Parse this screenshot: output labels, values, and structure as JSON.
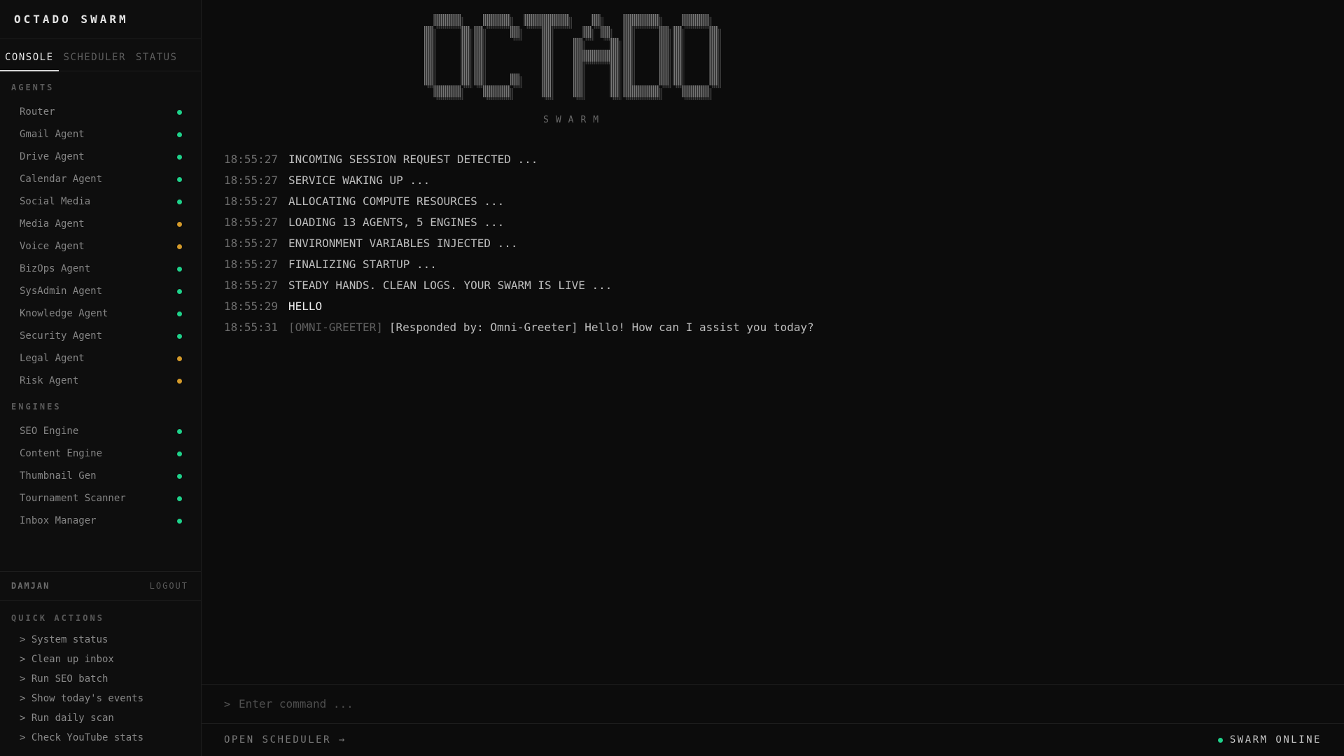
{
  "brand": "OCTADO SWARM",
  "tabs": [
    {
      "label": "CONSOLE",
      "active": true
    },
    {
      "label": "SCHEDULER",
      "active": false
    },
    {
      "label": "STATUS",
      "active": false
    }
  ],
  "sections": {
    "agents": "AGENTS",
    "engines": "ENGINES",
    "quick_actions": "QUICK ACTIONS"
  },
  "colors": {
    "online": "#1fd18a",
    "busy": "#d49a2a"
  },
  "agents": [
    {
      "label": "Router",
      "status": "online"
    },
    {
      "label": "Gmail Agent",
      "status": "online"
    },
    {
      "label": "Drive Agent",
      "status": "online"
    },
    {
      "label": "Calendar Agent",
      "status": "online"
    },
    {
      "label": "Social Media",
      "status": "online"
    },
    {
      "label": "Media Agent",
      "status": "busy"
    },
    {
      "label": "Voice Agent",
      "status": "busy"
    },
    {
      "label": "BizOps Agent",
      "status": "online"
    },
    {
      "label": "SysAdmin Agent",
      "status": "online"
    },
    {
      "label": "Knowledge Agent",
      "status": "online"
    },
    {
      "label": "Security Agent",
      "status": "online"
    },
    {
      "label": "Legal Agent",
      "status": "busy"
    },
    {
      "label": "Risk Agent",
      "status": "busy"
    }
  ],
  "engines": [
    {
      "label": "SEO Engine",
      "status": "online"
    },
    {
      "label": "Content Engine",
      "status": "online"
    },
    {
      "label": "Thumbnail Gen",
      "status": "online"
    },
    {
      "label": "Tournament Scanner",
      "status": "online"
    },
    {
      "label": "Inbox Manager",
      "status": "online"
    }
  ],
  "user": {
    "name": "DAMJAN",
    "logout": "LOGOUT"
  },
  "quick_actions": [
    "> System status",
    "> Clean up inbox",
    "> Run SEO batch",
    "> Show today's events",
    "> Run daily scan",
    "> Check YouTube stats"
  ],
  "logo": {
    "sub": "SWARM"
  },
  "log": [
    {
      "time": "18:55:27",
      "tag": "",
      "text": "INCOMING SESSION REQUEST DETECTED ...",
      "strong": false
    },
    {
      "time": "18:55:27",
      "tag": "",
      "text": "SERVICE WAKING UP ...",
      "strong": false
    },
    {
      "time": "18:55:27",
      "tag": "",
      "text": "ALLOCATING COMPUTE RESOURCES ...",
      "strong": false
    },
    {
      "time": "18:55:27",
      "tag": "",
      "text": "LOADING 13 AGENTS, 5 ENGINES ...",
      "strong": false
    },
    {
      "time": "18:55:27",
      "tag": "",
      "text": "ENVIRONMENT VARIABLES INJECTED ...",
      "strong": false
    },
    {
      "time": "18:55:27",
      "tag": "",
      "text": "FINALIZING STARTUP ...",
      "strong": false
    },
    {
      "time": "18:55:27",
      "tag": "",
      "text": "STEADY HANDS. CLEAN LOGS. YOUR SWARM IS LIVE ...",
      "strong": false
    },
    {
      "time": "18:55:29",
      "tag": "",
      "text": "HELLO",
      "strong": true
    },
    {
      "time": "18:55:31",
      "tag": "[OMNI-GREETER]",
      "text": "[Responded by: Omni-Greeter] Hello! How can I assist you today?",
      "strong": false
    }
  ],
  "command": {
    "prompt": ">",
    "placeholder": "Enter command ...",
    "value": ""
  },
  "footer": {
    "open_scheduler": "OPEN SCHEDULER →",
    "status": "SWARM ONLINE",
    "status_state": "online"
  }
}
